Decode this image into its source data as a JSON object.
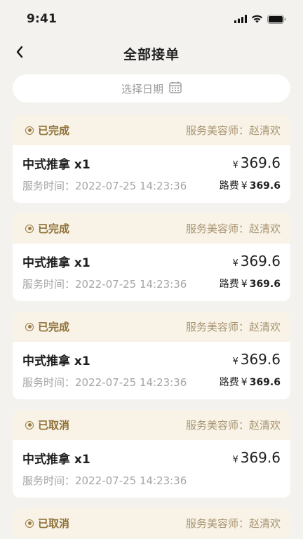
{
  "status_bar": {
    "time": "9:41"
  },
  "nav": {
    "title": "全部接单"
  },
  "date_picker": {
    "placeholder": "选择日期"
  },
  "orders": [
    {
      "status": "已完成",
      "beautician": "服务美容师：赵清欢",
      "service": "中式推拿 x1",
      "currency": "¥",
      "price": "369.6",
      "time_label": "服务时间：",
      "time": "2022-07-25 14:23:36",
      "fee_label": "路费",
      "fee": "369.6"
    },
    {
      "status": "已完成",
      "beautician": "服务美容师：赵清欢",
      "service": "中式推拿 x1",
      "currency": "¥",
      "price": "369.6",
      "time_label": "服务时间：",
      "time": "2022-07-25 14:23:36",
      "fee_label": "路费",
      "fee": "369.6"
    },
    {
      "status": "已完成",
      "beautician": "服务美容师：赵清欢",
      "service": "中式推拿 x1",
      "currency": "¥",
      "price": "369.6",
      "time_label": "服务时间：",
      "time": "2022-07-25 14:23:36",
      "fee_label": "路费",
      "fee": "369.6"
    },
    {
      "status": "已取消",
      "beautician": "服务美容师：赵清欢",
      "service": "中式推拿 x1",
      "currency": "¥",
      "price": "369.6",
      "time_label": "服务时间：",
      "time": "2022-07-25 14:23:36"
    },
    {
      "status": "已取消",
      "beautician": "服务美容师：赵清欢"
    }
  ],
  "icons": {
    "status_bar": [
      "signal-icon",
      "wifi-icon",
      "battery-icon"
    ],
    "back": "chevron-left-icon",
    "calendar": "calendar-icon",
    "status": "status-dot-icon"
  },
  "colors": {
    "background": "#f3f2ef",
    "card_header": "#f8f3e6",
    "status_gold": "#8f7038",
    "beautician_text": "#a89372",
    "muted_text": "#a5a5a5"
  }
}
